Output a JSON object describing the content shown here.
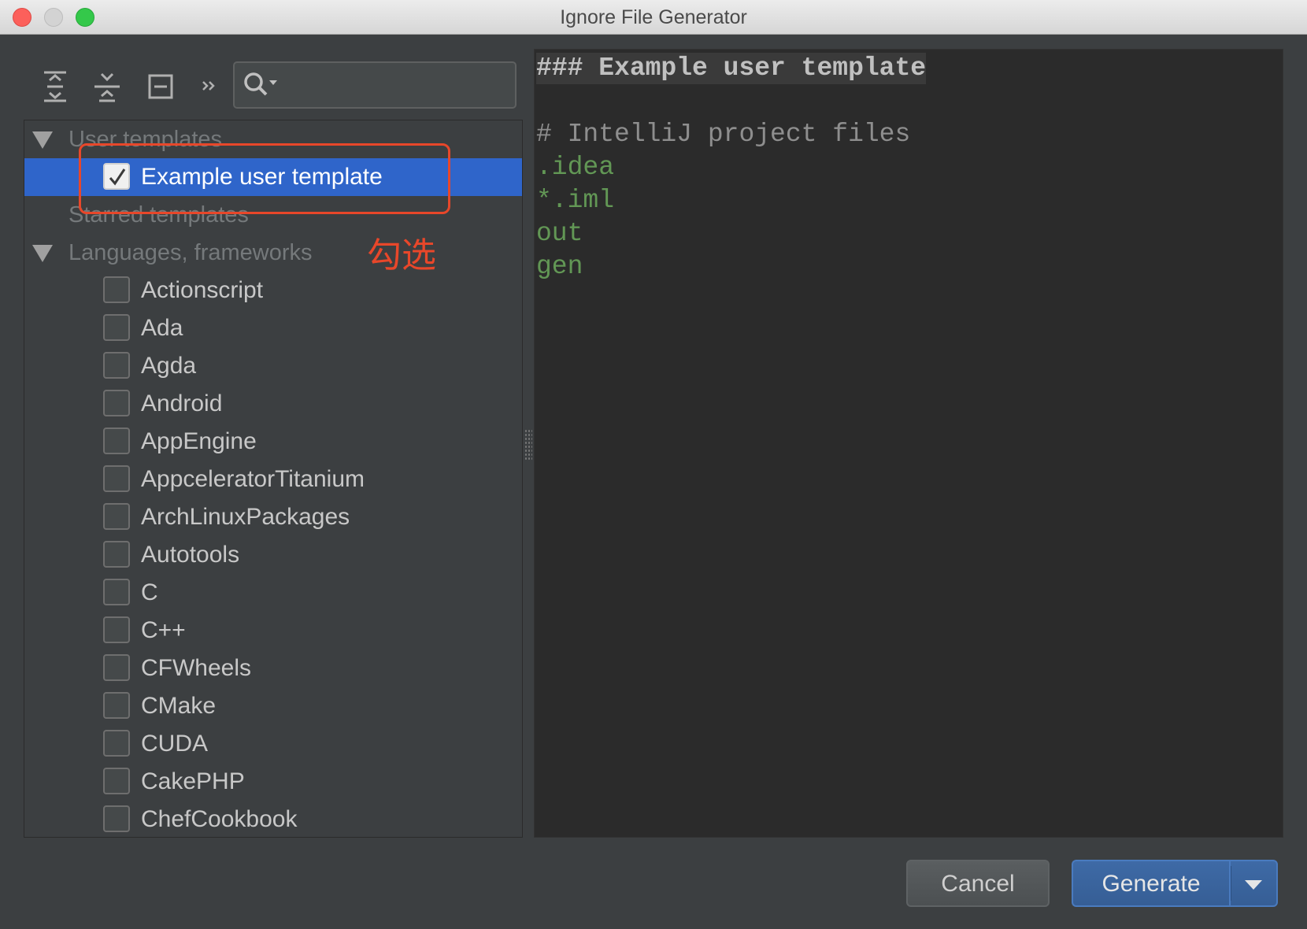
{
  "window": {
    "title": "Ignore File Generator"
  },
  "toolbar": {
    "icons": [
      "expand-all-icon",
      "collapse-all-icon",
      "hide-panel-icon",
      "more-icon"
    ],
    "search": {
      "value": "",
      "placeholder": ""
    }
  },
  "tree": {
    "groups": {
      "user_templates": "User templates",
      "starred_templates": "Starred templates",
      "languages": "Languages, frameworks"
    },
    "selected_item": {
      "label": "Example user template",
      "checked": true
    },
    "items": [
      {
        "label": "Actionscript",
        "checked": false
      },
      {
        "label": "Ada",
        "checked": false
      },
      {
        "label": "Agda",
        "checked": false
      },
      {
        "label": "Android",
        "checked": false
      },
      {
        "label": "AppEngine",
        "checked": false
      },
      {
        "label": "AppceleratorTitanium",
        "checked": false
      },
      {
        "label": "ArchLinuxPackages",
        "checked": false
      },
      {
        "label": "Autotools",
        "checked": false
      },
      {
        "label": "C",
        "checked": false
      },
      {
        "label": "C++",
        "checked": false
      },
      {
        "label": "CFWheels",
        "checked": false
      },
      {
        "label": "CMake",
        "checked": false
      },
      {
        "label": "CUDA",
        "checked": false
      },
      {
        "label": "CakePHP",
        "checked": false
      },
      {
        "label": "ChefCookbook",
        "checked": false
      }
    ]
  },
  "annotation": {
    "text": "勾选",
    "color": "#e8472a"
  },
  "preview": {
    "header": "### Example user template",
    "comment": "# IntelliJ project files",
    "entries": [
      ".idea",
      "*.iml",
      "out",
      "gen"
    ]
  },
  "buttons": {
    "cancel": "Cancel",
    "generate": "Generate"
  },
  "colors": {
    "selection": "#2f65ca",
    "background": "#3c3f41",
    "editor_background": "#2b2b2b",
    "entry_text": "#629755",
    "primary_button": "#3e6aa6"
  }
}
